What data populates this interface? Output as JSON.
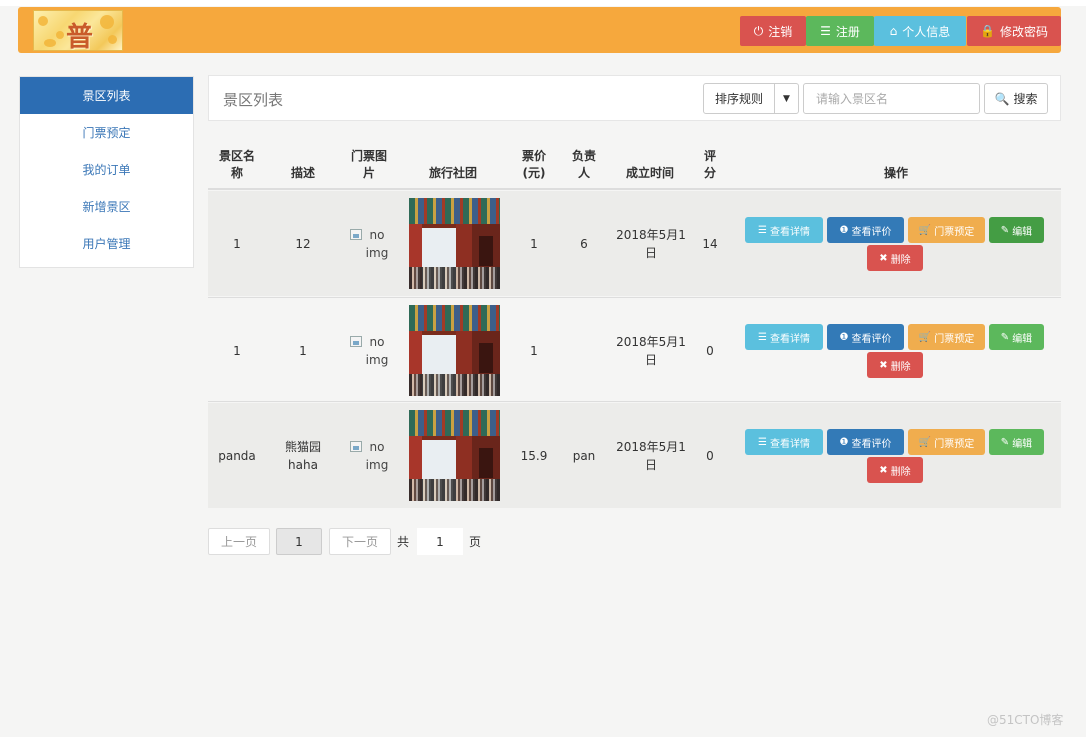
{
  "header": {
    "logo_text": "普",
    "buttons": [
      {
        "label": "注销",
        "icon": "power-icon"
      },
      {
        "label": "注册",
        "icon": "list-icon"
      },
      {
        "label": "个人信息",
        "icon": "home-icon"
      },
      {
        "label": "修改密码",
        "icon": "lock-icon"
      }
    ]
  },
  "sidebar": {
    "items": [
      {
        "label": "景区列表",
        "active": true
      },
      {
        "label": "门票预定",
        "active": false
      },
      {
        "label": "我的订单",
        "active": false
      },
      {
        "label": "新增景区",
        "active": false
      },
      {
        "label": "用户管理",
        "active": false
      }
    ]
  },
  "main": {
    "title": "景区列表",
    "sort_label": "排序规则",
    "search_placeholder": "请输入景区名",
    "search_button": "搜索"
  },
  "table": {
    "columns": [
      "景区名\n称",
      "描述",
      "门票图\n片",
      "旅行社团",
      "票价\n(元)",
      "负责\n人",
      "成立时间",
      "评\n分",
      "操作"
    ],
    "rows": [
      {
        "name": "1",
        "desc": "12",
        "img_alt": "no\nimg",
        "price": "1",
        "owner": "6",
        "date": "2018年5月1\n日",
        "score": "14"
      },
      {
        "name": "1",
        "desc": "1",
        "img_alt": "no\nimg",
        "price": "1",
        "owner": "",
        "date": "2018年5月1\n日",
        "score": "0"
      },
      {
        "name": "panda",
        "desc": "熊猫园\nhaha",
        "img_alt": "no\nimg",
        "price": "15.9",
        "owner": "pan",
        "date": "2018年5月1\n日",
        "score": "0"
      }
    ],
    "actions": {
      "detail": "查看详情",
      "review": "查看评价",
      "book": "门票预定",
      "edit": "编辑",
      "delete": "删除"
    }
  },
  "pagination": {
    "prev": "上一页",
    "current": "1",
    "next": "下一页",
    "total_prefix": "共",
    "total": "1",
    "total_suffix": "页"
  },
  "watermark": "@51CTO博客"
}
